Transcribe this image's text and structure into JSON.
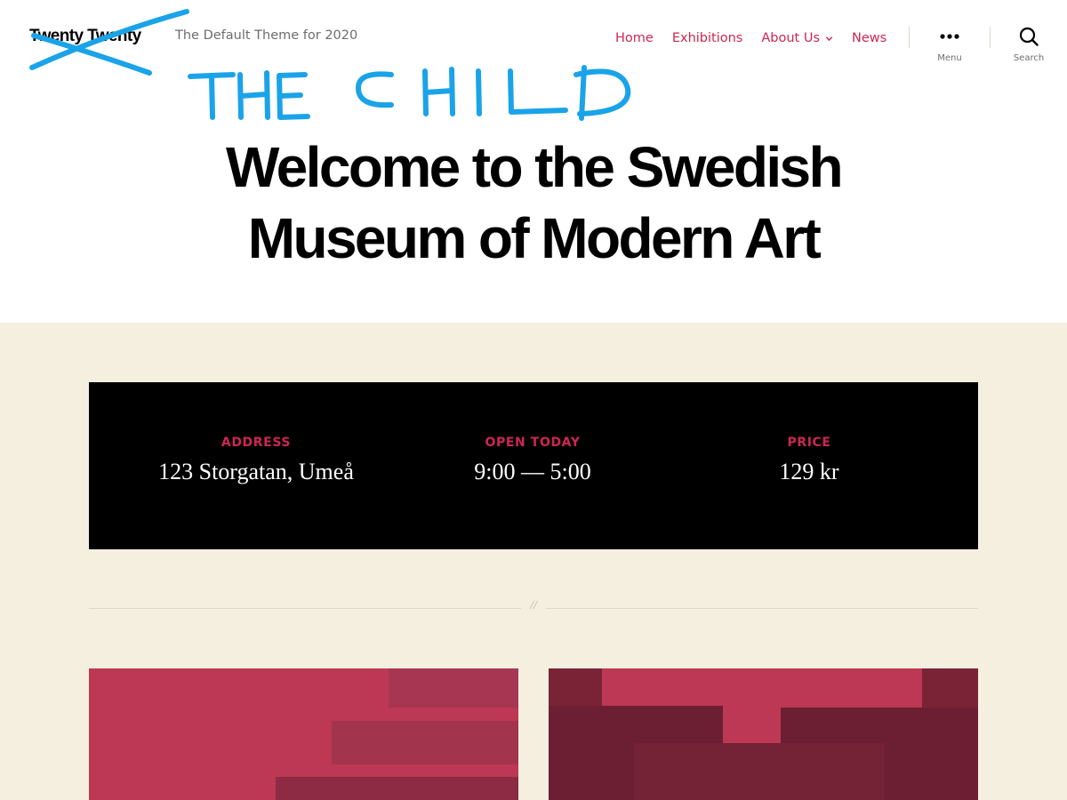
{
  "header": {
    "site_title": "Twenty Twenty",
    "site_description": "The Default Theme for 2020",
    "annotation": "THE CHILD",
    "nav": [
      {
        "label": "Home",
        "has_submenu": false
      },
      {
        "label": "Exhibitions",
        "has_submenu": false
      },
      {
        "label": "About Us",
        "has_submenu": true
      },
      {
        "label": "News",
        "has_submenu": false
      }
    ],
    "menu_toggle_label": "Menu",
    "search_toggle_label": "Search"
  },
  "hero": {
    "title_line1": "Welcome to the Swedish",
    "title_line2": "Museum of Modern Art"
  },
  "info": [
    {
      "label": "ADDRESS",
      "value": "123 Storgatan, Umeå"
    },
    {
      "label": "OPEN TODAY",
      "value": "9:00 — 5:00"
    },
    {
      "label": "PRICE",
      "value": "129 kr"
    }
  ],
  "separator_mark": "//",
  "colors": {
    "accent": "#cd2653",
    "band_background": "#f5efe0",
    "info_box": "#000000",
    "annotation_blue": "#1aa3e8",
    "secondary_text": "#6d6d6d"
  },
  "icons": [
    "chevron-down-icon",
    "ellipsis-menu-icon",
    "search-icon"
  ]
}
